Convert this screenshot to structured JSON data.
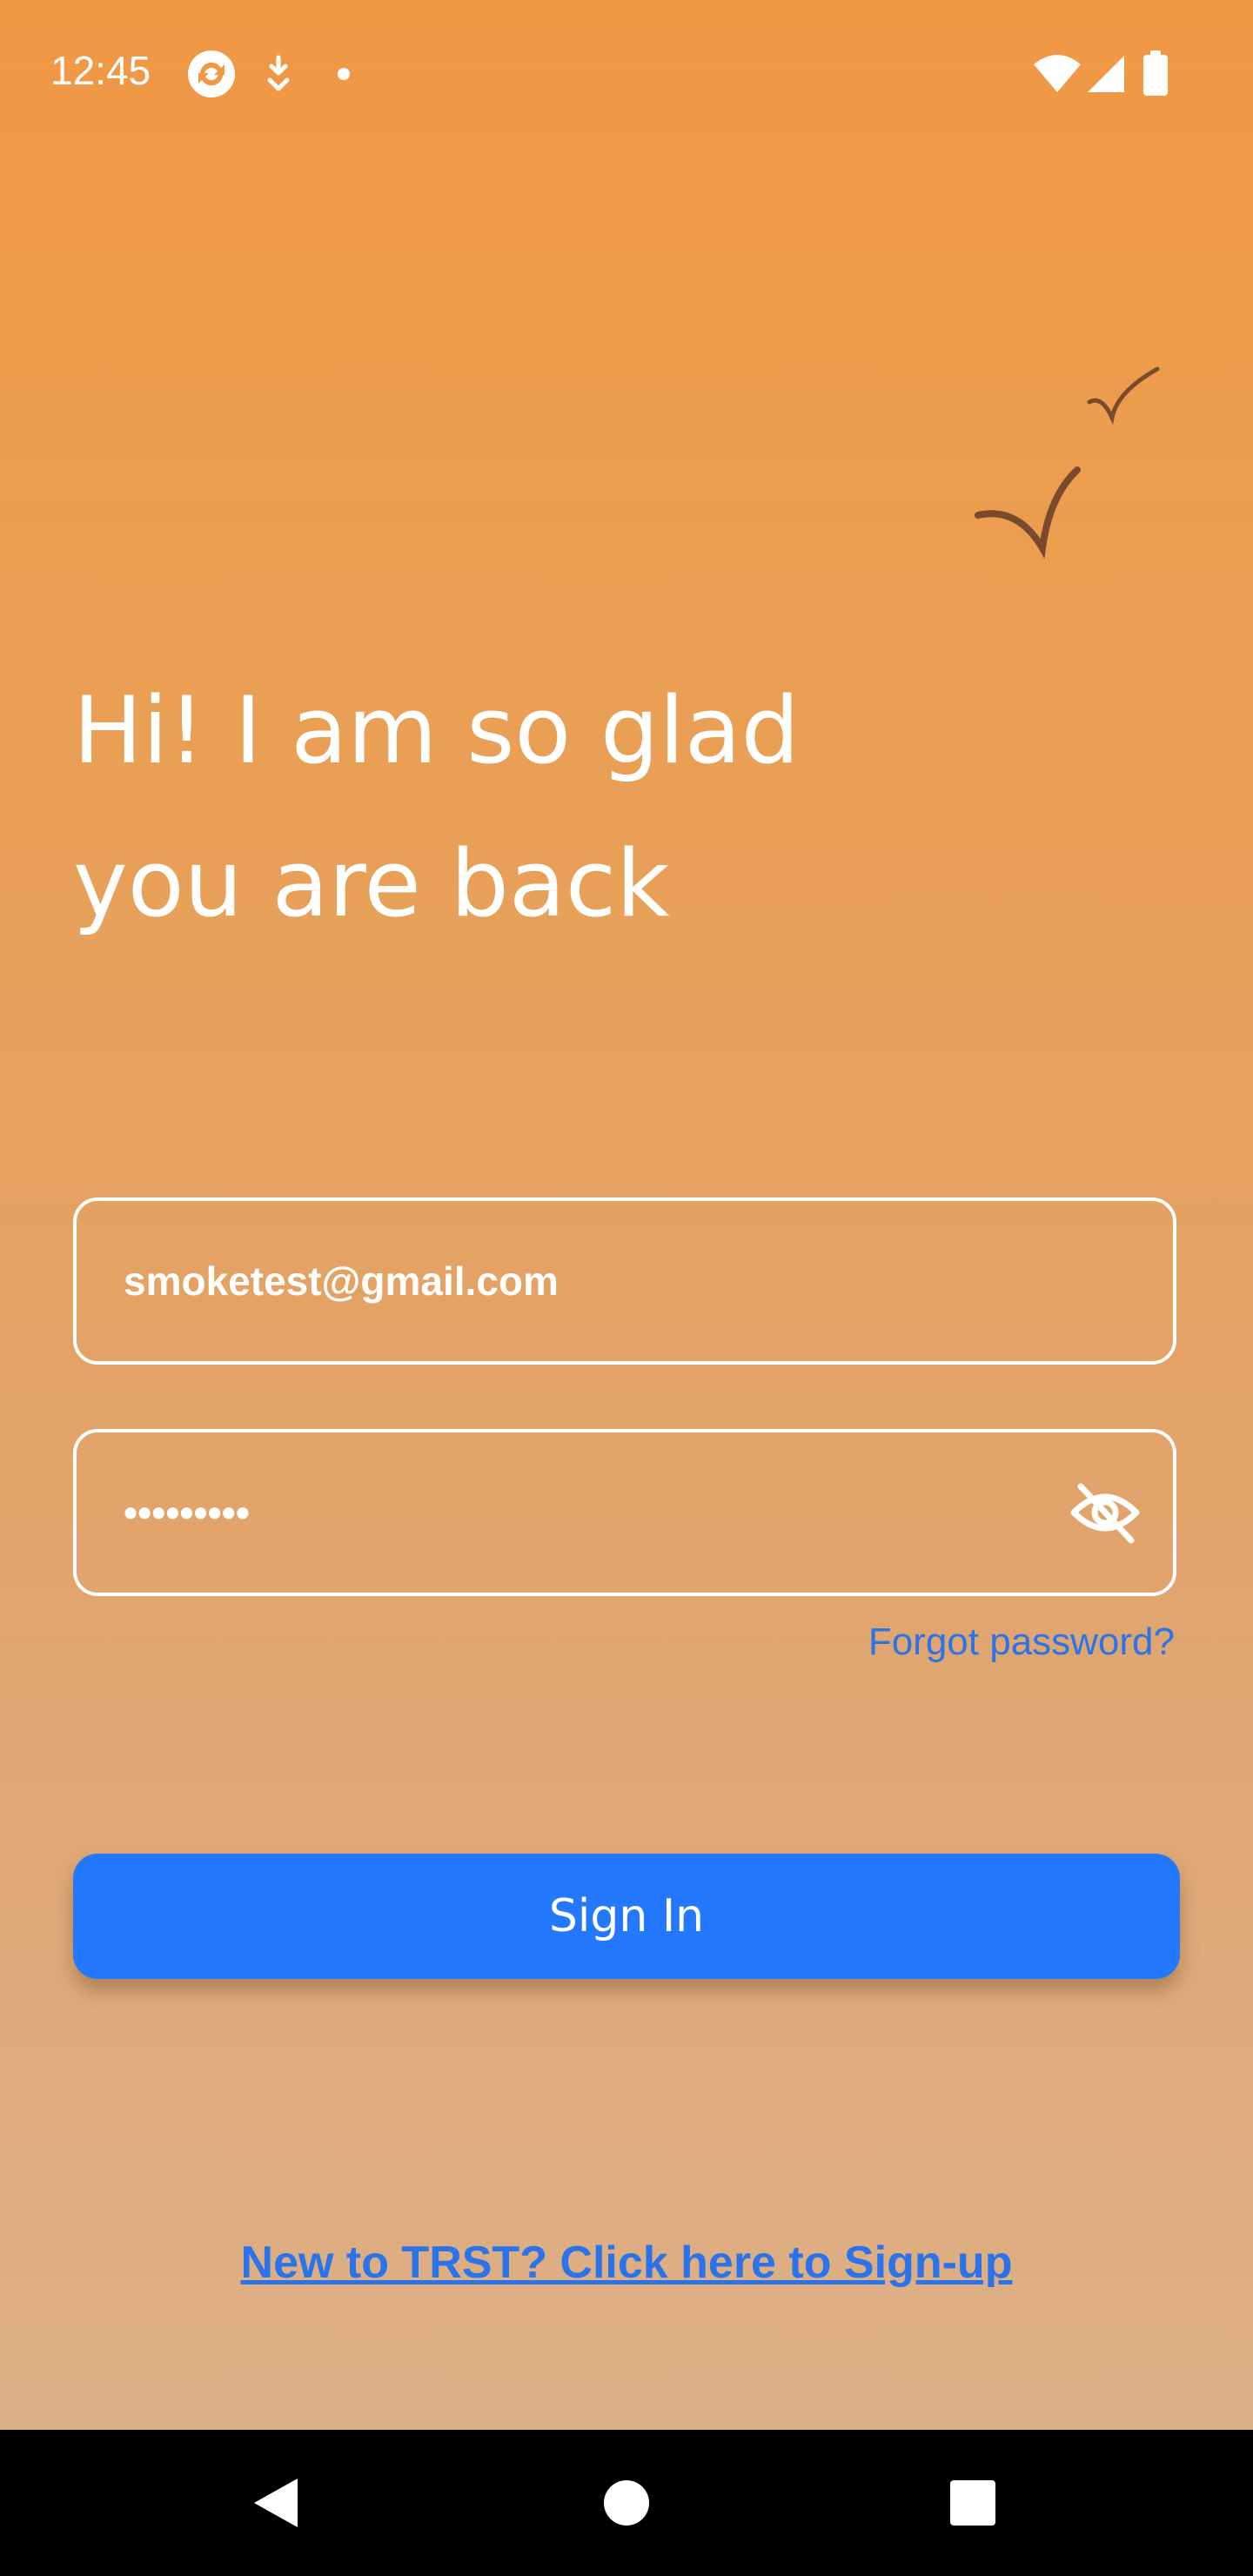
{
  "status_bar": {
    "time": "12:45",
    "left_icons": [
      "sync-app-icon",
      "download-notification-icon",
      "dot-notification-icon"
    ],
    "right_icons": [
      "wifi-icon",
      "cellular-signal-icon",
      "battery-icon"
    ]
  },
  "decoration": {
    "icon": "birds-illustration"
  },
  "greeting": {
    "line1": "Hi! I am so glad",
    "line2": "you are back"
  },
  "form": {
    "email_value": "smoketest@gmail.com",
    "password_value": "•••••••••",
    "password_toggle_icon": "eye-off-icon",
    "forgot_label": "Forgot password?",
    "signin_label": "Sign In",
    "signup_label": "New to TRST? Click here to Sign-up"
  },
  "nav_bar": {
    "back_icon": "back-triangle-icon",
    "home_icon": "home-circle-icon",
    "recents_icon": "recents-square-icon"
  },
  "colors": {
    "accent": "#2378fd",
    "link": "#2a73ea",
    "background_top": "#f09844",
    "background_bottom": "#ddb38d",
    "bird": "#7a4a2a"
  }
}
